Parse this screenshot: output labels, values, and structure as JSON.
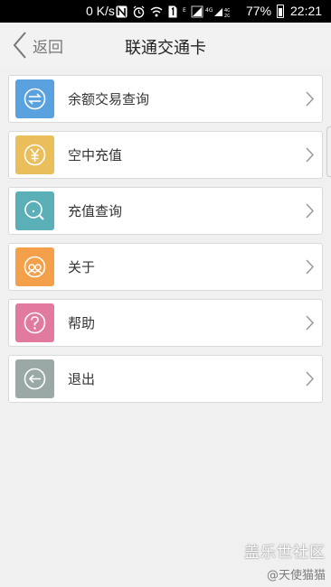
{
  "status_bar": {
    "net_speed": "0 K/s",
    "battery_percent": "77%",
    "time": "22:21",
    "icons": [
      "nfc-icon",
      "alarm-icon",
      "wifi-icon",
      "sim-icon",
      "signal-icon",
      "battery-icon"
    ]
  },
  "header": {
    "back_label": "返回",
    "title": "联通交通卡"
  },
  "menu": {
    "items": [
      {
        "label": "余额交易查询",
        "icon": "exchange-icon",
        "color": "#5aa1df"
      },
      {
        "label": "空中充值",
        "icon": "yen-icon",
        "color": "#e9be5b"
      },
      {
        "label": "充值查询",
        "icon": "search-icon",
        "color": "#5bb0b8"
      },
      {
        "label": "关于",
        "icon": "about-icon",
        "color": "#f4a04a"
      },
      {
        "label": "帮助",
        "icon": "help-icon",
        "color": "#e27aa0"
      },
      {
        "label": "退出",
        "icon": "logout-icon",
        "color": "#9aa9a6"
      }
    ]
  },
  "watermark": {
    "line1": "盖乐世社区",
    "line2": "@天使猫猫"
  }
}
